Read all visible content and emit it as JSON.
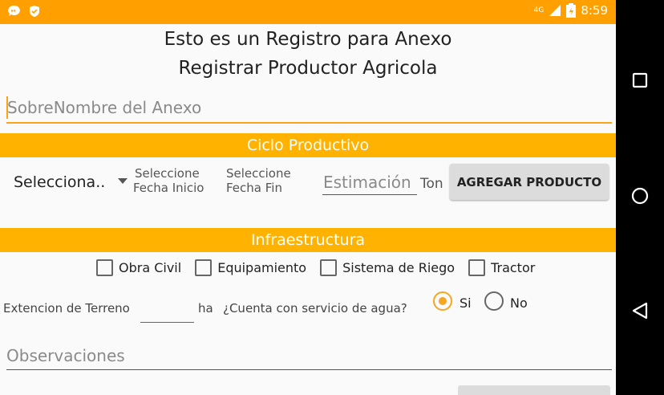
{
  "status_bar": {
    "network": "4G",
    "time": "8:59",
    "background_color": "#ffa000"
  },
  "header": {
    "title": "Esto es un Registro para Anexo",
    "subtitle": "Registrar Productor Agricola"
  },
  "nickname_field": {
    "placeholder": "SobreNombre del Anexo"
  },
  "ciclo_productivo": {
    "band_title": "Ciclo Productivo",
    "band_color": "#ffb300",
    "spinner_value": "Selecciona..",
    "fecha_inicio_line1": "Seleccione",
    "fecha_inicio_line2": "Fecha Inicio",
    "fecha_fin_line1": "Seleccione",
    "fecha_fin_line2": "Fecha Fin",
    "estimacion_placeholder": "Estimación",
    "unit": "Ton",
    "add_button": "AGREGAR PRODUCTO"
  },
  "infraestructura": {
    "band_title": "Infraestructura",
    "checkboxes": [
      "Obra Civil",
      "Equipamiento",
      "Sistema de Riego",
      "Tractor"
    ],
    "terreno_label": "Extencion de Terreno",
    "terreno_unit": "ha",
    "agua_question": "¿Cuenta con servicio de agua?",
    "agua_options": [
      "Si",
      "No"
    ],
    "agua_selected": "Si",
    "accent_color": "#f5a623"
  },
  "observaciones": {
    "placeholder": "Observaciones"
  }
}
